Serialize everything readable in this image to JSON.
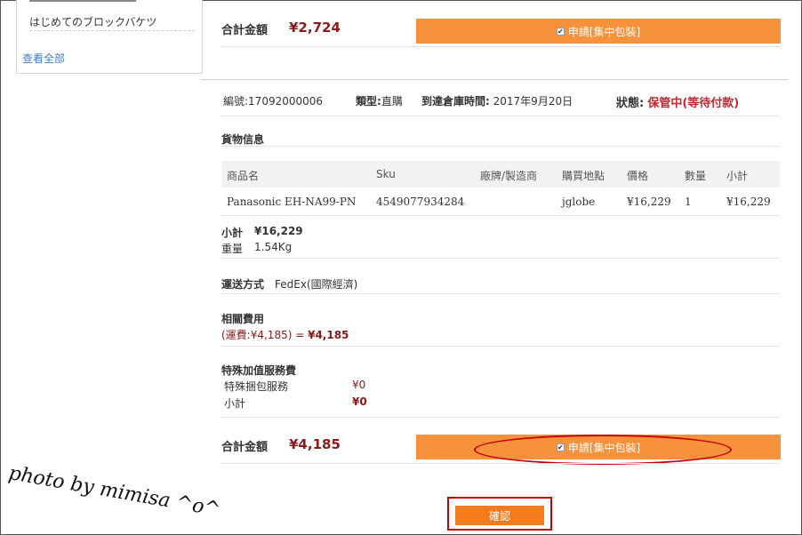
{
  "sidebar": {
    "item": "はじめてのブロックバケツ",
    "view_all": "查看全部"
  },
  "top_summary": {
    "total_label": "合計金額",
    "total_value": "¥2,724",
    "apply_label": "申請[集中包裝]"
  },
  "order": {
    "number_label": "編號:",
    "number": "17092000006",
    "type_label": "類型:",
    "type": "直購",
    "arrival_label": "到達倉庫時間:",
    "arrival": "2017年9月20日",
    "status_label": "狀態:",
    "status": "保管中(等待付款)"
  },
  "goods": {
    "section_title": "貨物信息",
    "columns": [
      "商品名",
      "Sku",
      "廠牌/製造商",
      "購買地點",
      "價格",
      "數量",
      "小計"
    ],
    "rows": [
      [
        "Panasonic EH-NA99-PN",
        "4549077934284",
        "",
        "jglobe",
        "¥16,229",
        "1",
        "¥16,229"
      ]
    ],
    "subtotal_label": "小計",
    "subtotal_value": "¥16,229",
    "weight_label": "重量",
    "weight_value": "1.54Kg"
  },
  "shipping": {
    "label": "運送方式",
    "value": "FedEx(國際經濟)"
  },
  "fees": {
    "title": "相關費用",
    "detail": "(運費:¥4,185) = ",
    "total": "¥4,185"
  },
  "special": {
    "title": "特殊加值服務費",
    "items": [
      {
        "label": "特殊捆包服務",
        "value": "¥0"
      },
      {
        "label": "小計",
        "value": "¥0"
      }
    ]
  },
  "bottom_summary": {
    "total_label": "合計金額",
    "total_value": "¥4,185",
    "apply_label": "申請[集中包裝]"
  },
  "confirm_label": "確認",
  "watermark": "photo by mimisa ^o^",
  "colors": {
    "accent_orange": "#f7923c",
    "confirm_orange": "#f47c1c",
    "price_red": "#8b1a1a",
    "status_red": "#c0282f",
    "highlight_red": "#c40000"
  }
}
